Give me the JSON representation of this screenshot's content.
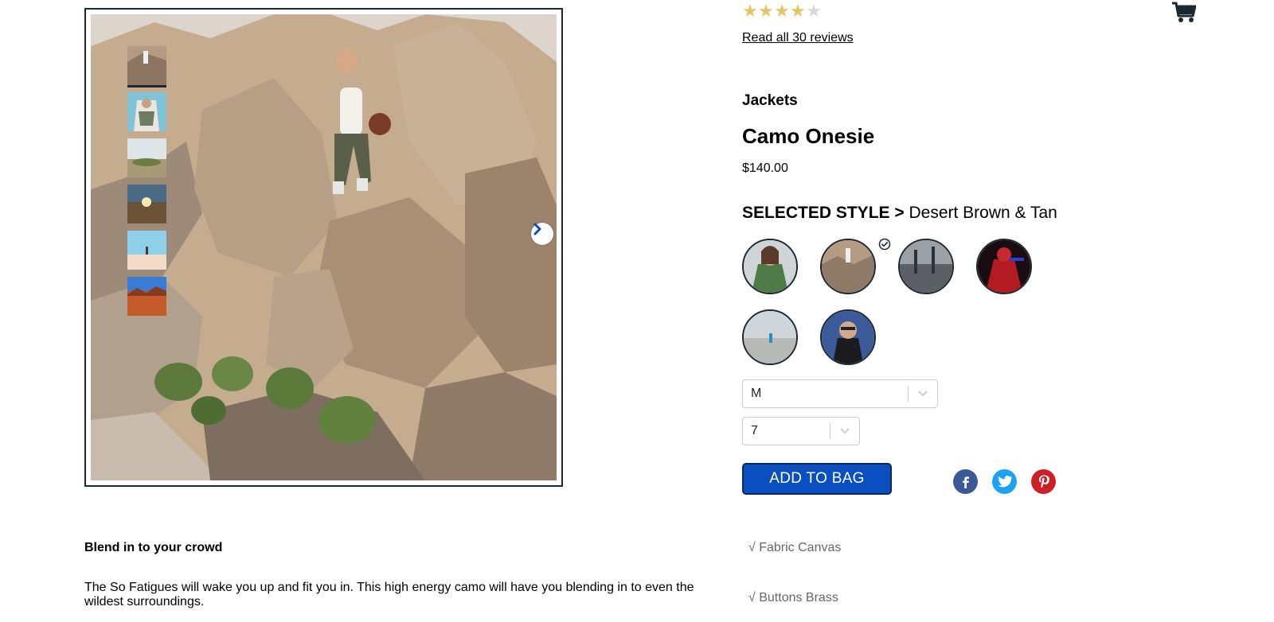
{
  "rating": {
    "stars_filled": 4,
    "stars_total": 5,
    "reviews_link": "Read all 30 reviews"
  },
  "header": {
    "cart_icon": "shopping-cart-icon"
  },
  "product": {
    "category": "Jackets",
    "name": "Camo Onesie",
    "price": "$140.00"
  },
  "style": {
    "label": "SELECTED STYLE >",
    "selected": "Desert Brown & Tan",
    "swatch_count": 6,
    "selected_index": 1
  },
  "gallery": {
    "thumbnail_count": 6,
    "active_thumbnail": 0,
    "next_icon": "chevron-right-icon"
  },
  "selectors": {
    "size_value": "M",
    "quantity_value": "7",
    "dropdown_icon": "chevron-down-icon"
  },
  "actions": {
    "add_to_bag": "ADD TO BAG"
  },
  "share": {
    "icons": [
      "facebook-icon",
      "twitter-icon",
      "pinterest-icon"
    ]
  },
  "features": [
    "√ Fabric Canvas",
    "√ Buttons Brass"
  ],
  "description": {
    "heading": "Blend in to your crowd",
    "body": "The So Fatigues will wake you up and fit you in. This high energy camo will have you blending in to even the wildest surroundings."
  },
  "colors": {
    "accent": "#0a4fbf",
    "dark": "#1c2830",
    "star": "#e3c565",
    "facebook": "#3b5998",
    "twitter": "#1da1f2",
    "pinterest": "#cb2027"
  }
}
